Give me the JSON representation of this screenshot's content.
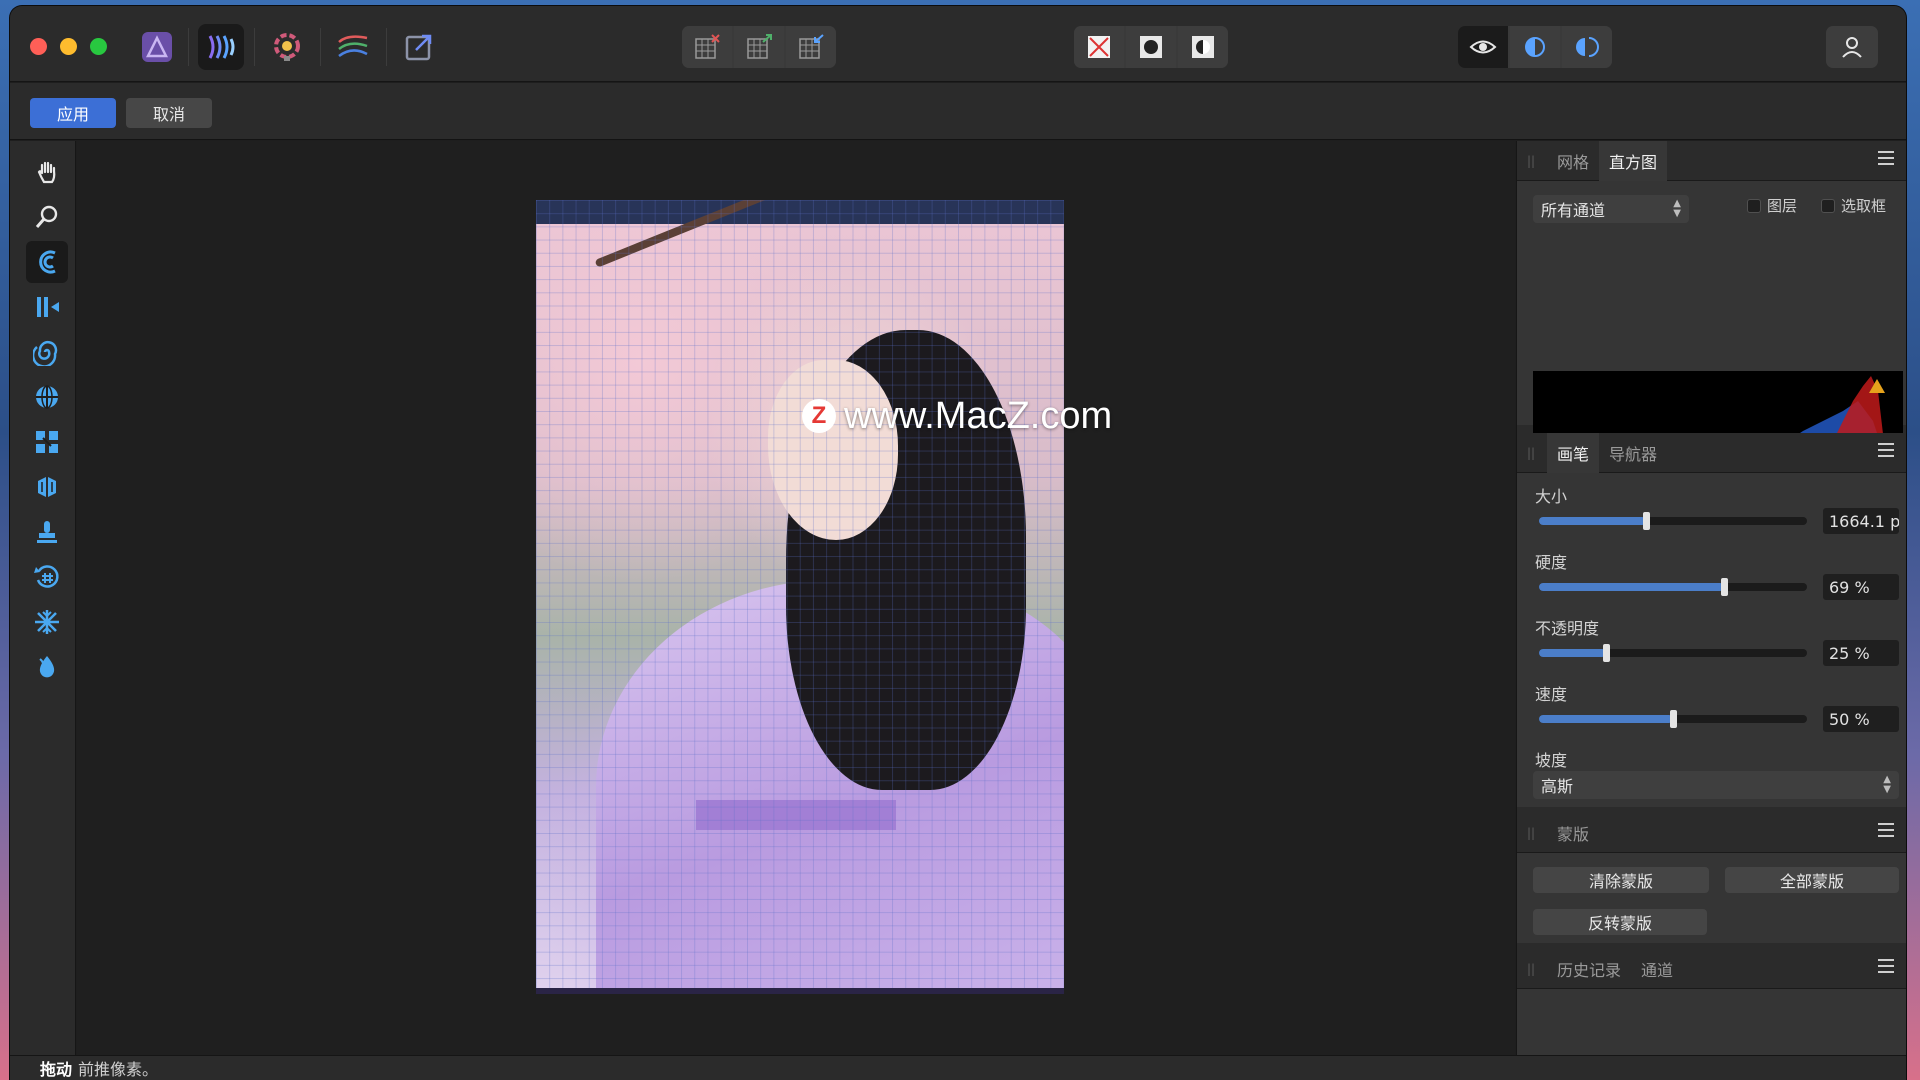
{
  "toolbar": {
    "apply_label": "应用",
    "cancel_label": "取消"
  },
  "watermark": {
    "logo_letter": "Z",
    "text": "www.MacZ.com"
  },
  "panels": {
    "histogram": {
      "tabs": [
        "网格",
        "直方图"
      ],
      "active_tab": "直方图",
      "channel_select": "所有通道",
      "checkbox_layer": "图层",
      "checkbox_selection": "选取框"
    },
    "brush": {
      "tabs": [
        "画笔",
        "导航器"
      ],
      "active_tab": "画笔",
      "size": {
        "label": "大小",
        "value": "1664.1 p",
        "level": 0.4
      },
      "hardness": {
        "label": "硬度",
        "value": "69 %",
        "level": 0.69
      },
      "opacity": {
        "label": "不透明度",
        "value": "25 %",
        "level": 0.25
      },
      "speed": {
        "label": "速度",
        "value": "50 %",
        "level": 0.5
      },
      "falloff": {
        "label": "坡度",
        "value": "高斯"
      }
    },
    "mask": {
      "title": "蒙版",
      "clear_label": "清除蒙版",
      "all_label": "全部蒙版",
      "invert_label": "反转蒙版"
    },
    "history": {
      "tabs": [
        "历史记录",
        "通道"
      ]
    }
  },
  "status": {
    "bold": "拖动",
    "text": "前推像素。"
  },
  "icons": {
    "left_tools": [
      "hand-icon",
      "zoom-icon",
      "forward-warp-icon",
      "push-left-icon",
      "twirl-icon",
      "pinch-punch-icon",
      "turbulence-icon",
      "mesh-clone-icon",
      "clone-icon",
      "reconstruct-icon",
      "freeze-icon",
      "thaw-icon"
    ],
    "accent": "#3c6fd6"
  }
}
